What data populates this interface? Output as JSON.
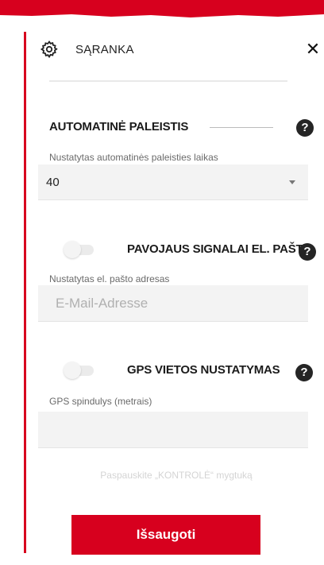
{
  "header": {
    "title": "SĄRANKA",
    "settings_icon": "gear-icon",
    "close_label": "✕"
  },
  "autostart": {
    "heading": "AUTOMATINĖ PALEISTIS",
    "field_label": "Nustatytas automatinės paleisties laikas",
    "selected_value": "40"
  },
  "email_alarms": {
    "heading": "PAVOJAUS SIGNALAI EL. PAŠTU",
    "field_label": "Nustatytas el. pašto adresas",
    "placeholder": "E-Mail-Adresse",
    "value": "",
    "enabled": false
  },
  "gps": {
    "heading": "GPS VIETOS NUSTATYMAS",
    "field_label": "GPS spindulys (metrais)",
    "value": "",
    "enabled": false
  },
  "help_label": "?",
  "footer_note": "Paspauskite „KONTROLĖ“ mygtuką",
  "save_label": "Išsaugoti",
  "colors": {
    "brand_red": "#d7001e",
    "help_icon": "#252525"
  }
}
